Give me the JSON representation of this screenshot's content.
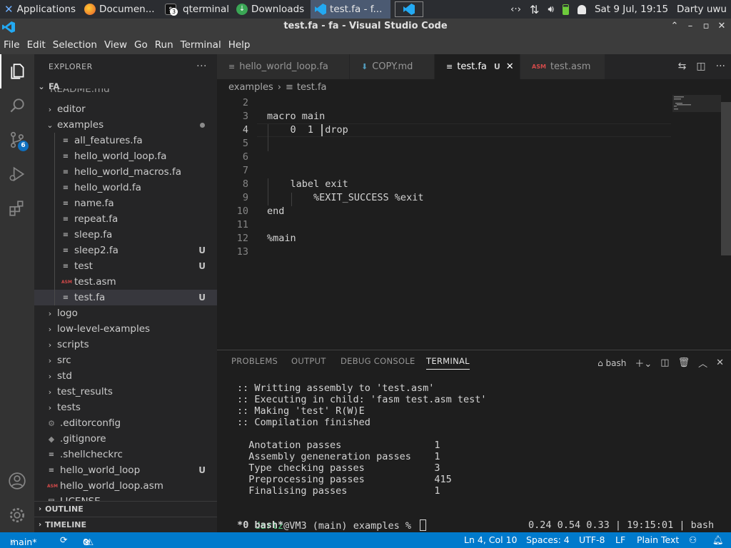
{
  "taskbar": {
    "applications": "Applications",
    "firefox_title": "Documen...",
    "qterminal_title": "qterminal",
    "qterminal_count": "3",
    "downloads_title": "Downloads",
    "vscode_title": "test.fa - f...",
    "clock": "Sat  9 Jul, 19:15",
    "user": "Darty uwu"
  },
  "window": {
    "title": "test.fa - fa - Visual Studio Code"
  },
  "menu": [
    "File",
    "Edit",
    "Selection",
    "View",
    "Go",
    "Run",
    "Terminal",
    "Help"
  ],
  "activity": {
    "scm_badge": "6"
  },
  "sidebar": {
    "header": "EXPLORER",
    "more": "···",
    "root": "FA",
    "partial_top": "README.md",
    "items": [
      {
        "label": "editor",
        "kind": "folder",
        "mark": ""
      },
      {
        "label": "examples",
        "kind": "folder-open",
        "mark": "dot"
      },
      {
        "label": "all_features.fa",
        "kind": "file",
        "mark": ""
      },
      {
        "label": "hello_world_loop.fa",
        "kind": "file",
        "mark": ""
      },
      {
        "label": "hello_world_macros.fa",
        "kind": "file",
        "mark": ""
      },
      {
        "label": "hello_world.fa",
        "kind": "file",
        "mark": ""
      },
      {
        "label": "name.fa",
        "kind": "file",
        "mark": ""
      },
      {
        "label": "repeat.fa",
        "kind": "file",
        "mark": ""
      },
      {
        "label": "sleep.fa",
        "kind": "file",
        "mark": ""
      },
      {
        "label": "sleep2.fa",
        "kind": "file",
        "mark": "U"
      },
      {
        "label": "test",
        "kind": "file",
        "mark": "U"
      },
      {
        "label": "test.asm",
        "kind": "asm",
        "mark": ""
      },
      {
        "label": "test.fa",
        "kind": "file",
        "mark": "U"
      },
      {
        "label": "logo",
        "kind": "folder",
        "mark": ""
      },
      {
        "label": "low-level-examples",
        "kind": "folder",
        "mark": ""
      },
      {
        "label": "scripts",
        "kind": "folder",
        "mark": ""
      },
      {
        "label": "src",
        "kind": "folder",
        "mark": ""
      },
      {
        "label": "std",
        "kind": "folder",
        "mark": ""
      },
      {
        "label": "test_results",
        "kind": "folder",
        "mark": ""
      },
      {
        "label": "tests",
        "kind": "folder",
        "mark": ""
      },
      {
        "label": ".editorconfig",
        "kind": "gear",
        "mark": ""
      },
      {
        "label": ".gitignore",
        "kind": "diamond",
        "mark": ""
      },
      {
        "label": ".shellcheckrc",
        "kind": "file",
        "mark": ""
      },
      {
        "label": "hello_world_loop",
        "kind": "file",
        "mark": "U"
      },
      {
        "label": "hello_world_loop.asm",
        "kind": "asm",
        "mark": ""
      },
      {
        "label": "LICENSE",
        "kind": "license",
        "mark": ""
      }
    ],
    "selected": "test.fa",
    "outline": "OUTLINE",
    "timeline": "TIMELINE"
  },
  "tabs": [
    {
      "label": "hello_world_loop.fa",
      "icon": "lines",
      "active": false
    },
    {
      "label": "COPY.md",
      "icon": "md",
      "active": false
    },
    {
      "label": "test.fa",
      "icon": "lines",
      "active": true,
      "status": "U"
    },
    {
      "label": "test.asm",
      "icon": "asm",
      "active": false
    }
  ],
  "breadcrumb": [
    "examples",
    "test.fa"
  ],
  "editor": {
    "lines": [
      {
        "n": "2",
        "text": ""
      },
      {
        "n": "3",
        "text": "macro main"
      },
      {
        "n": "4",
        "text": "    0  1  drop"
      },
      {
        "n": "5",
        "text": ""
      },
      {
        "n": "6",
        "text": ""
      },
      {
        "n": "7",
        "text": ""
      },
      {
        "n": "8",
        "text": "    label exit"
      },
      {
        "n": "9",
        "text": "        %EXIT_SUCCESS %exit"
      },
      {
        "n": "10",
        "text": "end"
      },
      {
        "n": "11",
        "text": ""
      },
      {
        "n": "12",
        "text": "%main"
      },
      {
        "n": "13",
        "text": ""
      }
    ],
    "current_line": "4"
  },
  "panel": {
    "tabs": [
      "PROBLEMS",
      "OUTPUT",
      "DEBUG CONSOLE",
      "TERMINAL"
    ],
    "shell": "bash",
    "terminal": [
      ":: Writting assembly to 'test.asm'",
      ":: Executing in child: 'fasm test.asm test'",
      ":: Making 'test' R(W)E",
      ":: Compilation finished",
      "",
      "  Anotation passes                1",
      "  Assembly geneneration passes    1",
      "  Type checking passes            3",
      "  Preprocessing passes            415",
      "  Finalising passes               1"
    ],
    "prompt_user": "dartz",
    "prompt_rest": "@VM3 (main) examples % ",
    "tmux_left": " *0 bash*",
    "tmux_right": "0.24 0.54 0.33 | 19:15:01 | bash"
  },
  "status": {
    "branch": "main*",
    "errors": "0",
    "warnings": "0",
    "position": "Ln 4, Col 10",
    "spaces": "Spaces: 4",
    "encoding": "UTF-8",
    "eol": "LF",
    "language": "Plain Text"
  },
  "colors": {
    "accent": "#007acc",
    "prompt_user": "#4ec97e",
    "asm_icon": "#d34a4a"
  }
}
